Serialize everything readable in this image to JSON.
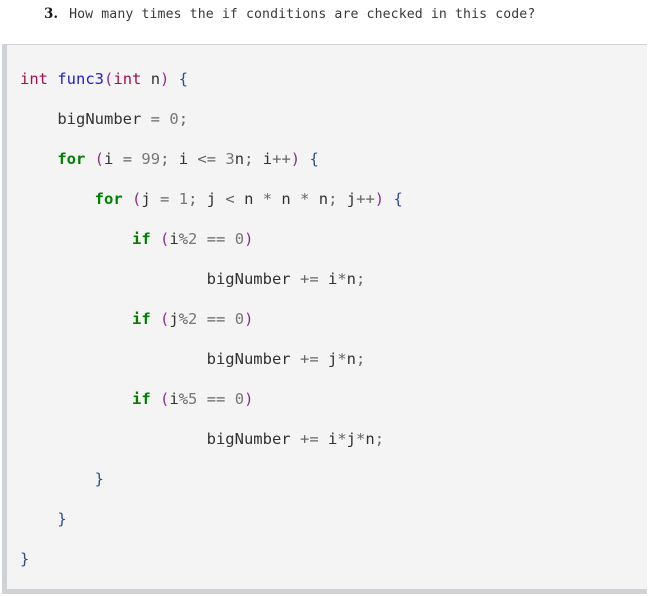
{
  "question": {
    "number": "3.",
    "text": "How many times the if conditions are checked in this code?"
  },
  "code_block": {
    "language": "c",
    "background_color": "#f4f4f4",
    "border_color": "#cfd2d6",
    "colors": {
      "type": "#a11050",
      "function": "#2020cc",
      "paren": "#8b2f8b",
      "keyword": "#008000",
      "number": "#777777",
      "identifier": "#333333",
      "operator": "#666666",
      "brace": "#2c4e8a"
    },
    "lines": [
      {
        "indent": 0,
        "tokens": [
          {
            "t": "int",
            "c": "tok-type"
          },
          {
            "t": " ",
            "c": "tok-plain"
          },
          {
            "t": "func3",
            "c": "tok-func"
          },
          {
            "t": "(",
            "c": "tok-paren"
          },
          {
            "t": "int",
            "c": "tok-type"
          },
          {
            "t": " n",
            "c": "tok-ident"
          },
          {
            "t": ")",
            "c": "tok-paren"
          },
          {
            "t": " ",
            "c": "tok-plain"
          },
          {
            "t": "{",
            "c": "tok-brace"
          }
        ]
      },
      {
        "indent": 1,
        "tokens": [
          {
            "t": "bigNumber",
            "c": "tok-ident"
          },
          {
            "t": " ",
            "c": "tok-plain"
          },
          {
            "t": "=",
            "c": "tok-op"
          },
          {
            "t": " ",
            "c": "tok-plain"
          },
          {
            "t": "0",
            "c": "tok-num"
          },
          {
            "t": ";",
            "c": "tok-op"
          }
        ]
      },
      {
        "indent": 1,
        "tokens": [
          {
            "t": "for",
            "c": "tok-kw"
          },
          {
            "t": " ",
            "c": "tok-plain"
          },
          {
            "t": "(",
            "c": "tok-paren"
          },
          {
            "t": "i",
            "c": "tok-ident"
          },
          {
            "t": " ",
            "c": "tok-plain"
          },
          {
            "t": "=",
            "c": "tok-op"
          },
          {
            "t": " ",
            "c": "tok-plain"
          },
          {
            "t": "99",
            "c": "tok-num"
          },
          {
            "t": ";",
            "c": "tok-op"
          },
          {
            "t": " i ",
            "c": "tok-ident"
          },
          {
            "t": "<=",
            "c": "tok-op"
          },
          {
            "t": " ",
            "c": "tok-plain"
          },
          {
            "t": "3",
            "c": "tok-num"
          },
          {
            "t": "n",
            "c": "tok-ident"
          },
          {
            "t": ";",
            "c": "tok-op"
          },
          {
            "t": " i",
            "c": "tok-ident"
          },
          {
            "t": "++",
            "c": "tok-op"
          },
          {
            "t": ")",
            "c": "tok-paren"
          },
          {
            "t": " ",
            "c": "tok-plain"
          },
          {
            "t": "{",
            "c": "tok-brace"
          }
        ]
      },
      {
        "indent": 2,
        "tokens": [
          {
            "t": "for",
            "c": "tok-kw"
          },
          {
            "t": " ",
            "c": "tok-plain"
          },
          {
            "t": "(",
            "c": "tok-paren"
          },
          {
            "t": "j",
            "c": "tok-ident"
          },
          {
            "t": " ",
            "c": "tok-plain"
          },
          {
            "t": "=",
            "c": "tok-op"
          },
          {
            "t": " ",
            "c": "tok-plain"
          },
          {
            "t": "1",
            "c": "tok-num"
          },
          {
            "t": ";",
            "c": "tok-op"
          },
          {
            "t": " j ",
            "c": "tok-ident"
          },
          {
            "t": "<",
            "c": "tok-op"
          },
          {
            "t": " n ",
            "c": "tok-ident"
          },
          {
            "t": "*",
            "c": "tok-op"
          },
          {
            "t": " n ",
            "c": "tok-ident"
          },
          {
            "t": "*",
            "c": "tok-op"
          },
          {
            "t": " n",
            "c": "tok-ident"
          },
          {
            "t": ";",
            "c": "tok-op"
          },
          {
            "t": " j",
            "c": "tok-ident"
          },
          {
            "t": "++",
            "c": "tok-op"
          },
          {
            "t": ")",
            "c": "tok-paren"
          },
          {
            "t": " ",
            "c": "tok-plain"
          },
          {
            "t": "{",
            "c": "tok-brace"
          }
        ]
      },
      {
        "indent": 3,
        "tokens": [
          {
            "t": "if",
            "c": "tok-kw"
          },
          {
            "t": " ",
            "c": "tok-plain"
          },
          {
            "t": "(",
            "c": "tok-paren"
          },
          {
            "t": "i",
            "c": "tok-ident"
          },
          {
            "t": "%",
            "c": "tok-op"
          },
          {
            "t": "2",
            "c": "tok-num"
          },
          {
            "t": " ",
            "c": "tok-plain"
          },
          {
            "t": "==",
            "c": "tok-op"
          },
          {
            "t": " ",
            "c": "tok-plain"
          },
          {
            "t": "0",
            "c": "tok-num"
          },
          {
            "t": ")",
            "c": "tok-paren"
          }
        ]
      },
      {
        "indent": 5,
        "tokens": [
          {
            "t": "bigNumber",
            "c": "tok-ident"
          },
          {
            "t": " ",
            "c": "tok-plain"
          },
          {
            "t": "+=",
            "c": "tok-op"
          },
          {
            "t": " i",
            "c": "tok-ident"
          },
          {
            "t": "*",
            "c": "tok-op"
          },
          {
            "t": "n",
            "c": "tok-ident"
          },
          {
            "t": ";",
            "c": "tok-op"
          }
        ]
      },
      {
        "indent": 3,
        "tokens": [
          {
            "t": "if",
            "c": "tok-kw"
          },
          {
            "t": " ",
            "c": "tok-plain"
          },
          {
            "t": "(",
            "c": "tok-paren"
          },
          {
            "t": "j",
            "c": "tok-ident"
          },
          {
            "t": "%",
            "c": "tok-op"
          },
          {
            "t": "2",
            "c": "tok-num"
          },
          {
            "t": " ",
            "c": "tok-plain"
          },
          {
            "t": "==",
            "c": "tok-op"
          },
          {
            "t": " ",
            "c": "tok-plain"
          },
          {
            "t": "0",
            "c": "tok-num"
          },
          {
            "t": ")",
            "c": "tok-paren"
          }
        ]
      },
      {
        "indent": 5,
        "tokens": [
          {
            "t": "bigNumber",
            "c": "tok-ident"
          },
          {
            "t": " ",
            "c": "tok-plain"
          },
          {
            "t": "+=",
            "c": "tok-op"
          },
          {
            "t": " j",
            "c": "tok-ident"
          },
          {
            "t": "*",
            "c": "tok-op"
          },
          {
            "t": "n",
            "c": "tok-ident"
          },
          {
            "t": ";",
            "c": "tok-op"
          }
        ]
      },
      {
        "indent": 3,
        "tokens": [
          {
            "t": "if",
            "c": "tok-kw"
          },
          {
            "t": " ",
            "c": "tok-plain"
          },
          {
            "t": "(",
            "c": "tok-paren"
          },
          {
            "t": "i",
            "c": "tok-ident"
          },
          {
            "t": "%",
            "c": "tok-op"
          },
          {
            "t": "5",
            "c": "tok-num"
          },
          {
            "t": " ",
            "c": "tok-plain"
          },
          {
            "t": "==",
            "c": "tok-op"
          },
          {
            "t": " ",
            "c": "tok-plain"
          },
          {
            "t": "0",
            "c": "tok-num"
          },
          {
            "t": ")",
            "c": "tok-paren"
          }
        ]
      },
      {
        "indent": 5,
        "tokens": [
          {
            "t": "bigNumber",
            "c": "tok-ident"
          },
          {
            "t": " ",
            "c": "tok-plain"
          },
          {
            "t": "+=",
            "c": "tok-op"
          },
          {
            "t": " i",
            "c": "tok-ident"
          },
          {
            "t": "*",
            "c": "tok-op"
          },
          {
            "t": "j",
            "c": "tok-ident"
          },
          {
            "t": "*",
            "c": "tok-op"
          },
          {
            "t": "n",
            "c": "tok-ident"
          },
          {
            "t": ";",
            "c": "tok-op"
          }
        ]
      },
      {
        "indent": 2,
        "tokens": [
          {
            "t": "}",
            "c": "tok-brace"
          }
        ]
      },
      {
        "indent": 1,
        "tokens": [
          {
            "t": "}",
            "c": "tok-brace"
          }
        ]
      },
      {
        "indent": 0,
        "tokens": [
          {
            "t": "}",
            "c": "tok-brace"
          }
        ]
      }
    ]
  }
}
